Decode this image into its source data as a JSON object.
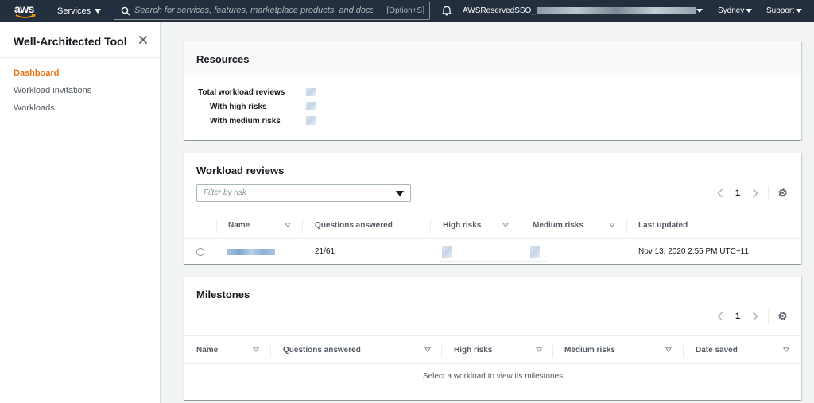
{
  "topnav": {
    "logo": "aws",
    "services_label": "Services",
    "search_placeholder": "Search for services, features, marketplace products, and docs",
    "search_shortcut": "[Option+S]",
    "account_prefix": "AWSReservedSSO_",
    "region": "Sydney",
    "support": "Support"
  },
  "sidenav": {
    "title": "Well-Architected Tool",
    "items": [
      {
        "label": "Dashboard",
        "active": true
      },
      {
        "label": "Workload invitations",
        "active": false
      },
      {
        "label": "Workloads",
        "active": false
      }
    ]
  },
  "resources": {
    "title": "Resources",
    "total_label": "Total workload reviews",
    "high_label": "With high risks",
    "medium_label": "With medium risks"
  },
  "workload_reviews": {
    "title": "Workload reviews",
    "filter_placeholder": "Filter by risk",
    "page": "1",
    "columns": [
      "Name",
      "Questions answered",
      "High risks",
      "Medium risks",
      "Last updated"
    ],
    "rows": [
      {
        "questions_answered": "21/61",
        "last_updated": "Nov 13, 2020 2:55 PM UTC+11"
      }
    ]
  },
  "milestones": {
    "title": "Milestones",
    "page": "1",
    "columns": [
      "Name",
      "Questions answered",
      "High risks",
      "Medium risks",
      "Date saved"
    ],
    "empty_message": "Select a workload to view its milestones"
  },
  "colors": {
    "nav_bg": "#232f3e",
    "accent": "#ec7211",
    "page_bg": "#f2f3f3"
  }
}
